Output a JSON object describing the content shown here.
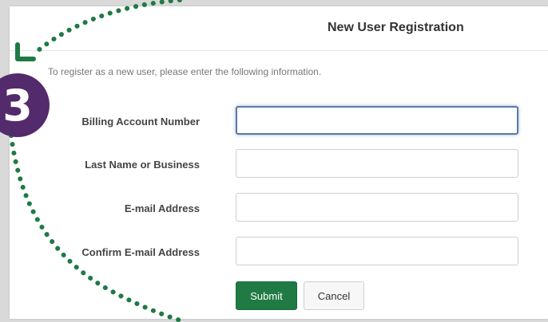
{
  "form": {
    "title": "New User Registration",
    "intro": "To register as a new user, please enter the following information.",
    "fields": [
      {
        "label": "Billing Account Number",
        "value": "",
        "placeholder": ""
      },
      {
        "label": "Last Name or Business",
        "value": "",
        "placeholder": ""
      },
      {
        "label": "E-mail Address",
        "value": "",
        "placeholder": ""
      },
      {
        "label": "Confirm E-mail Address",
        "value": "",
        "placeholder": ""
      }
    ],
    "submit_label": "Submit",
    "cancel_label": "Cancel"
  },
  "annotation": {
    "step_number": "3",
    "step_color": "#532a6b",
    "arrow_color": "#1f7a44"
  },
  "colors": {
    "submit_bg": "#1f7a44",
    "focus_border": "#5a7aa8"
  }
}
